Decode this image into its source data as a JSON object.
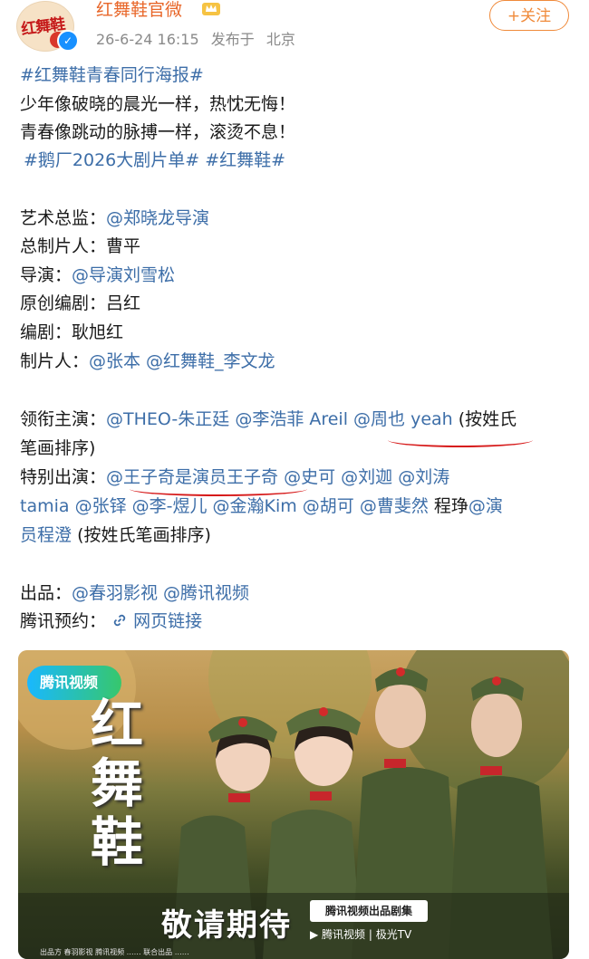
{
  "header": {
    "avatar_text": "红舞鞋",
    "account_name": "红舞鞋官微",
    "timestamp": "26-6-24 16:15",
    "location_prefix": "发布于",
    "location": "北京",
    "follow_label": "+关注"
  },
  "post": {
    "hashtag_main": "#红舞鞋青春同行海报#",
    "line1": "少年像破晓的晨光一样，热忱无悔！",
    "line2": "青春像跳动的脉搏一样，滚烫不息！",
    "hashtag_1": "#鹅厂2026大剧片单#",
    "hashtag_2": "#红舞鞋#",
    "credits": [
      {
        "label": "艺术总监：",
        "value": "@郑晓龙导演",
        "is_link": true
      },
      {
        "label": "总制片人：",
        "value": "曹平",
        "is_link": false
      },
      {
        "label": "导演：",
        "value": "@导演刘雪松",
        "is_link": true
      },
      {
        "label": "原创编剧：",
        "value": "吕红",
        "is_link": false
      },
      {
        "label": "编剧：",
        "value": "耿旭红",
        "is_link": false
      },
      {
        "label": "制片人：",
        "value": "@张本 @红舞鞋_李文龙",
        "is_link": true
      }
    ],
    "lead_label": "领衔主演：",
    "lead_1": "@THEO-朱正廷",
    "lead_2": "@李浩菲 Areil",
    "lead_3": "@周也 yeah",
    "lead_suffix_a": "(按姓氏",
    "lead_suffix_b": "笔画排序)",
    "special_label": "特别出演：",
    "special_1": "@王子奇是演员王子奇",
    "special_2": "@史可",
    "special_3": "@刘迦",
    "special_4": "@刘涛",
    "special_line2a": "tamia @张铎 @李-煜儿 @金瀚Kim @胡可 @曹斐然",
    "special_line2b": "程琤",
    "special_line2c": "@演",
    "special_line3a": "员程澄",
    "special_line3b": "(按姓氏笔画排序)",
    "producer_label": "出品：",
    "producer_value": "@春羽影视 @腾讯视频",
    "reserve_label": "腾讯预约：",
    "reserve_link": "网页链接"
  },
  "poster": {
    "logo": "腾讯视频",
    "title_chars": [
      "红",
      "舞",
      "鞋"
    ],
    "tagline": "敬请期待",
    "badge": "腾讯视频出品剧集",
    "apps": "▶ 腾讯视频 | 极光TV",
    "credits": "出品方 春羽影视 腾讯视频   ……   联合出品   ……"
  },
  "colors": {
    "link": "#3d6ea8",
    "accent": "#f08a3a",
    "underline": "#d61818",
    "verified": "#1890ff"
  }
}
